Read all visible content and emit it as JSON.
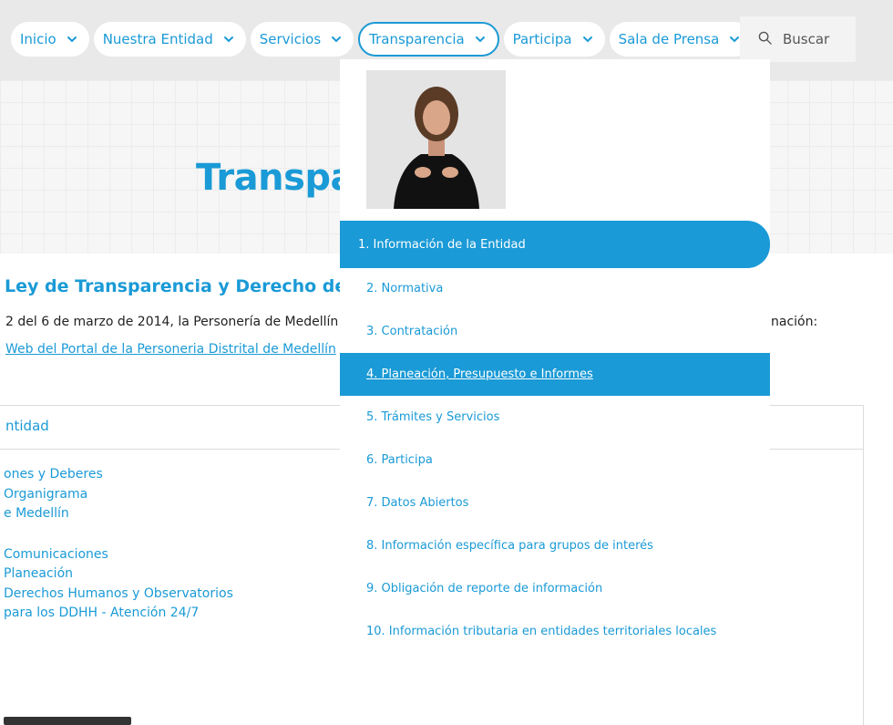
{
  "nav": {
    "items": [
      {
        "label": "Inicio"
      },
      {
        "label": "Nuestra Entidad"
      },
      {
        "label": "Servicios"
      },
      {
        "label": "Transparencia"
      },
      {
        "label": "Participa"
      },
      {
        "label": "Sala de Prensa"
      }
    ],
    "search_label": "Buscar"
  },
  "hero": {
    "title": "Transparencia"
  },
  "law": {
    "title": "Ley de Transparencia y Derecho de",
    "text": "2 del 6 de marzo de 2014, la Personería de Medellín",
    "text_right": "nación:",
    "link": "Web del Portal de la Personeria Distrital de Medellín"
  },
  "panel": {
    "heading": "ntidad",
    "items": [
      "ones y Deberes",
      "Organigrama",
      "e Medellín",
      "",
      "Comunicaciones",
      "Planeación",
      "Derechos Humanos y Observatorios",
      "para los DDHH - Atención 24/7"
    ]
  },
  "dropdown": {
    "items": [
      {
        "label": "1. Información de la Entidad"
      },
      {
        "label": "2. Normativa"
      },
      {
        "label": "3. Contratación"
      },
      {
        "label": "4. Planeación, Presupuesto e Informes"
      },
      {
        "label": "5. Trámites y Servicios"
      },
      {
        "label": "6. Participa"
      },
      {
        "label": "7. Datos Abiertos"
      },
      {
        "label": "8. Información específica para grupos de interés"
      },
      {
        "label": "9. Obligación de reporte de información"
      },
      {
        "label": "10. Información tributaria en entidades territoriales locales"
      }
    ]
  },
  "colors": {
    "accent": "#1a9ad6",
    "nav_bg": "#e9e9e9"
  }
}
